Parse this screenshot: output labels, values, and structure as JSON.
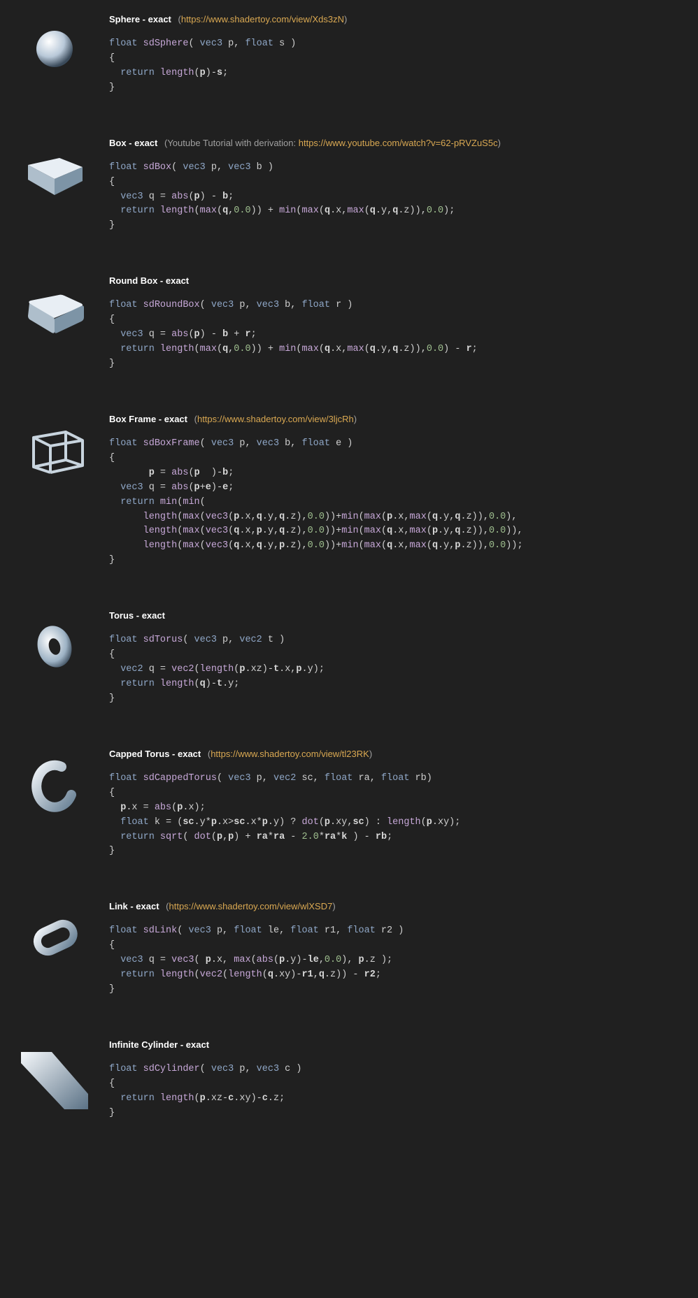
{
  "entries": [
    {
      "id": "sphere",
      "title": "Sphere - exact",
      "note_prefix": "(",
      "note_link_text": "https://www.shadertoy.com/view/Xds3zN",
      "note_suffix": ")",
      "code_html": "<span class='kw'>float</span> <span class='fn'>sdSphere</span>( <span class='kw'>vec3</span> p, <span class='kw'>float</span> s )\n{\n  <span class='kw'>return</span> <span class='call'>length</span>(<span class='id'>p</span>)-<span class='id'>s</span>;\n}"
    },
    {
      "id": "box",
      "title": "Box - exact",
      "note_prefix": "(Youtube Tutorial with derivation: ",
      "note_link_text": "https://www.youtube.com/watch?v=62-pRVZuS5c",
      "note_suffix": ")",
      "code_html": "<span class='kw'>float</span> <span class='fn'>sdBox</span>( <span class='kw'>vec3</span> p, <span class='kw'>vec3</span> b )\n{\n  <span class='kw'>vec3</span> q = <span class='call'>abs</span>(<span class='id'>p</span>) - <span class='id'>b</span>;\n  <span class='kw'>return</span> <span class='call'>length</span>(<span class='call'>max</span>(<span class='id'>q</span>,<span class='num'>0.0</span>)) + <span class='call'>min</span>(<span class='call'>max</span>(<span class='id'>q</span>.x,<span class='call'>max</span>(<span class='id'>q</span>.y,<span class='id'>q</span>.z)),<span class='num'>0.0</span>);\n}"
    },
    {
      "id": "roundbox",
      "title": "Round Box - exact",
      "note_prefix": "",
      "note_link_text": "",
      "note_suffix": "",
      "code_html": "<span class='kw'>float</span> <span class='fn'>sdRoundBox</span>( <span class='kw'>vec3</span> p, <span class='kw'>vec3</span> b, <span class='kw'>float</span> r )\n{\n  <span class='kw'>vec3</span> q = <span class='call'>abs</span>(<span class='id'>p</span>) - <span class='id'>b</span> + <span class='id'>r</span>;\n  <span class='kw'>return</span> <span class='call'>length</span>(<span class='call'>max</span>(<span class='id'>q</span>,<span class='num'>0.0</span>)) + <span class='call'>min</span>(<span class='call'>max</span>(<span class='id'>q</span>.x,<span class='call'>max</span>(<span class='id'>q</span>.y,<span class='id'>q</span>.z)),<span class='num'>0.0</span>) - <span class='id'>r</span>;\n}"
    },
    {
      "id": "boxframe",
      "title": "Box Frame - exact",
      "note_prefix": "(",
      "note_link_text": "https://www.shadertoy.com/view/3ljcRh",
      "note_suffix": ")",
      "code_html": "<span class='kw'>float</span> <span class='fn'>sdBoxFrame</span>( <span class='kw'>vec3</span> p, <span class='kw'>vec3</span> b, <span class='kw'>float</span> e )\n{\n       <span class='id'>p</span> = <span class='call'>abs</span>(<span class='id'>p</span>  )-<span class='id'>b</span>;\n  <span class='kw'>vec3</span> q = <span class='call'>abs</span>(<span class='id'>p</span>+<span class='id'>e</span>)-<span class='id'>e</span>;\n  <span class='kw'>return</span> <span class='call'>min</span>(<span class='call'>min</span>(\n      <span class='call'>length</span>(<span class='call'>max</span>(<span class='call'>vec3</span>(<span class='id'>p</span>.x,<span class='id'>q</span>.y,<span class='id'>q</span>.z),<span class='num'>0.0</span>))+<span class='call'>min</span>(<span class='call'>max</span>(<span class='id'>p</span>.x,<span class='call'>max</span>(<span class='id'>q</span>.y,<span class='id'>q</span>.z)),<span class='num'>0.0</span>),\n      <span class='call'>length</span>(<span class='call'>max</span>(<span class='call'>vec3</span>(<span class='id'>q</span>.x,<span class='id'>p</span>.y,<span class='id'>q</span>.z),<span class='num'>0.0</span>))+<span class='call'>min</span>(<span class='call'>max</span>(<span class='id'>q</span>.x,<span class='call'>max</span>(<span class='id'>p</span>.y,<span class='id'>q</span>.z)),<span class='num'>0.0</span>)),\n      <span class='call'>length</span>(<span class='call'>max</span>(<span class='call'>vec3</span>(<span class='id'>q</span>.x,<span class='id'>q</span>.y,<span class='id'>p</span>.z),<span class='num'>0.0</span>))+<span class='call'>min</span>(<span class='call'>max</span>(<span class='id'>q</span>.x,<span class='call'>max</span>(<span class='id'>q</span>.y,<span class='id'>p</span>.z)),<span class='num'>0.0</span>));\n}"
    },
    {
      "id": "torus",
      "title": "Torus - exact",
      "note_prefix": "",
      "note_link_text": "",
      "note_suffix": "",
      "code_html": "<span class='kw'>float</span> <span class='fn'>sdTorus</span>( <span class='kw'>vec3</span> p, <span class='kw'>vec2</span> t )\n{\n  <span class='kw'>vec2</span> q = <span class='call'>vec2</span>(<span class='call'>length</span>(<span class='id'>p</span>.xz)-<span class='id'>t</span>.x,<span class='id'>p</span>.y);\n  <span class='kw'>return</span> <span class='call'>length</span>(<span class='id'>q</span>)-<span class='id'>t</span>.y;\n}"
    },
    {
      "id": "captorus",
      "title": "Capped Torus - exact",
      "note_prefix": "(",
      "note_link_text": "https://www.shadertoy.com/view/tl23RK",
      "note_suffix": ")",
      "code_html": "<span class='kw'>float</span> <span class='fn'>sdCappedTorus</span>( <span class='kw'>vec3</span> p, <span class='kw'>vec2</span> sc, <span class='kw'>float</span> ra, <span class='kw'>float</span> rb)\n{\n  <span class='id'>p</span>.x = <span class='call'>abs</span>(<span class='id'>p</span>.x);\n  <span class='kw'>float</span> k = (<span class='id'>sc</span>.y*<span class='id'>p</span>.x&gt;<span class='id'>sc</span>.x*<span class='id'>p</span>.y) ? <span class='call'>dot</span>(<span class='id'>p</span>.xy,<span class='id'>sc</span>) : <span class='call'>length</span>(<span class='id'>p</span>.xy);\n  <span class='kw'>return</span> <span class='call'>sqrt</span>( <span class='call'>dot</span>(<span class='id'>p</span>,<span class='id'>p</span>) + <span class='id'>ra</span>*<span class='id'>ra</span> - <span class='num'>2.0</span>*<span class='id'>ra</span>*<span class='id'>k</span> ) - <span class='id'>rb</span>;\n}"
    },
    {
      "id": "link",
      "title": "Link - exact",
      "note_prefix": "(",
      "note_link_text": "https://www.shadertoy.com/view/wlXSD7",
      "note_suffix": ")",
      "code_html": "<span class='kw'>float</span> <span class='fn'>sdLink</span>( <span class='kw'>vec3</span> p, <span class='kw'>float</span> le, <span class='kw'>float</span> r1, <span class='kw'>float</span> r2 )\n{\n  <span class='kw'>vec3</span> q = <span class='call'>vec3</span>( <span class='id'>p</span>.x, <span class='call'>max</span>(<span class='call'>abs</span>(<span class='id'>p</span>.y)-<span class='id'>le</span>,<span class='num'>0.0</span>), <span class='id'>p</span>.z );\n  <span class='kw'>return</span> <span class='call'>length</span>(<span class='call'>vec2</span>(<span class='call'>length</span>(<span class='id'>q</span>.xy)-<span class='id'>r1</span>,<span class='id'>q</span>.z)) - <span class='id'>r2</span>;\n}"
    },
    {
      "id": "infcyl",
      "title": "Infinite Cylinder - exact",
      "note_prefix": "",
      "note_link_text": "",
      "note_suffix": "",
      "code_html": "<span class='kw'>float</span> <span class='fn'>sdCylinder</span>( <span class='kw'>vec3</span> p, <span class='kw'>vec3</span> c )\n{\n  <span class='kw'>return</span> <span class='call'>length</span>(<span class='id'>p</span>.xz-<span class='id'>c</span>.xy)-<span class='id'>c</span>.z;\n}"
    }
  ]
}
